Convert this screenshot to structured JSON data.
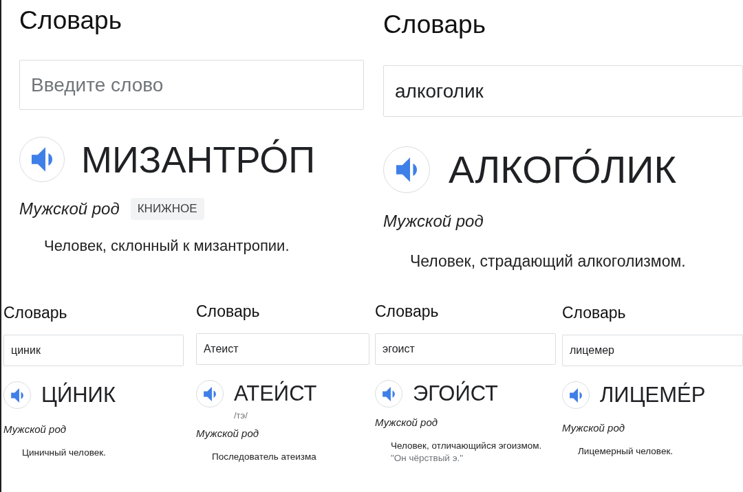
{
  "cards": [
    {
      "kind": "large",
      "title": "Словарь",
      "search": {
        "placeholder": "Введите слово"
      },
      "headword": "МИЗАНТРО́П",
      "gender": "Мужской род",
      "tag": "КНИЖНОЕ",
      "definition": "Человек, склонный к мизантропии."
    },
    {
      "kind": "large",
      "title": "Словарь",
      "search": {
        "value": "алкоголик"
      },
      "headword": "АЛКОГО́ЛИК",
      "gender": "Мужской род",
      "definition": "Человек, страдающий алкоголизмом."
    },
    {
      "kind": "small",
      "title": "Словарь",
      "search": {
        "value": "циник"
      },
      "headword": "ЦИ́НИК",
      "gender": "Мужской род",
      "definition": "Циничный человек."
    },
    {
      "kind": "small",
      "title": "Словарь",
      "search": {
        "value": "Атеист"
      },
      "headword": "АТЕИ́СТ",
      "transcription": "/тэ/",
      "gender": "Мужской род",
      "definition": "Последователь атеизма"
    },
    {
      "kind": "small",
      "title": "Словарь",
      "search": {
        "value": "эгоист"
      },
      "headword": "ЭГОИ́СТ",
      "gender": "Мужской род",
      "definition": "Человек, отличающийся эгоизмом.",
      "example": "\"Он чёрствый э.\""
    },
    {
      "kind": "small",
      "title": "Словарь",
      "search": {
        "value": "лицемер"
      },
      "headword": "ЛИЦЕМЕ́Р",
      "gender": "Мужской род",
      "definition": "Лицемерный человек."
    }
  ]
}
